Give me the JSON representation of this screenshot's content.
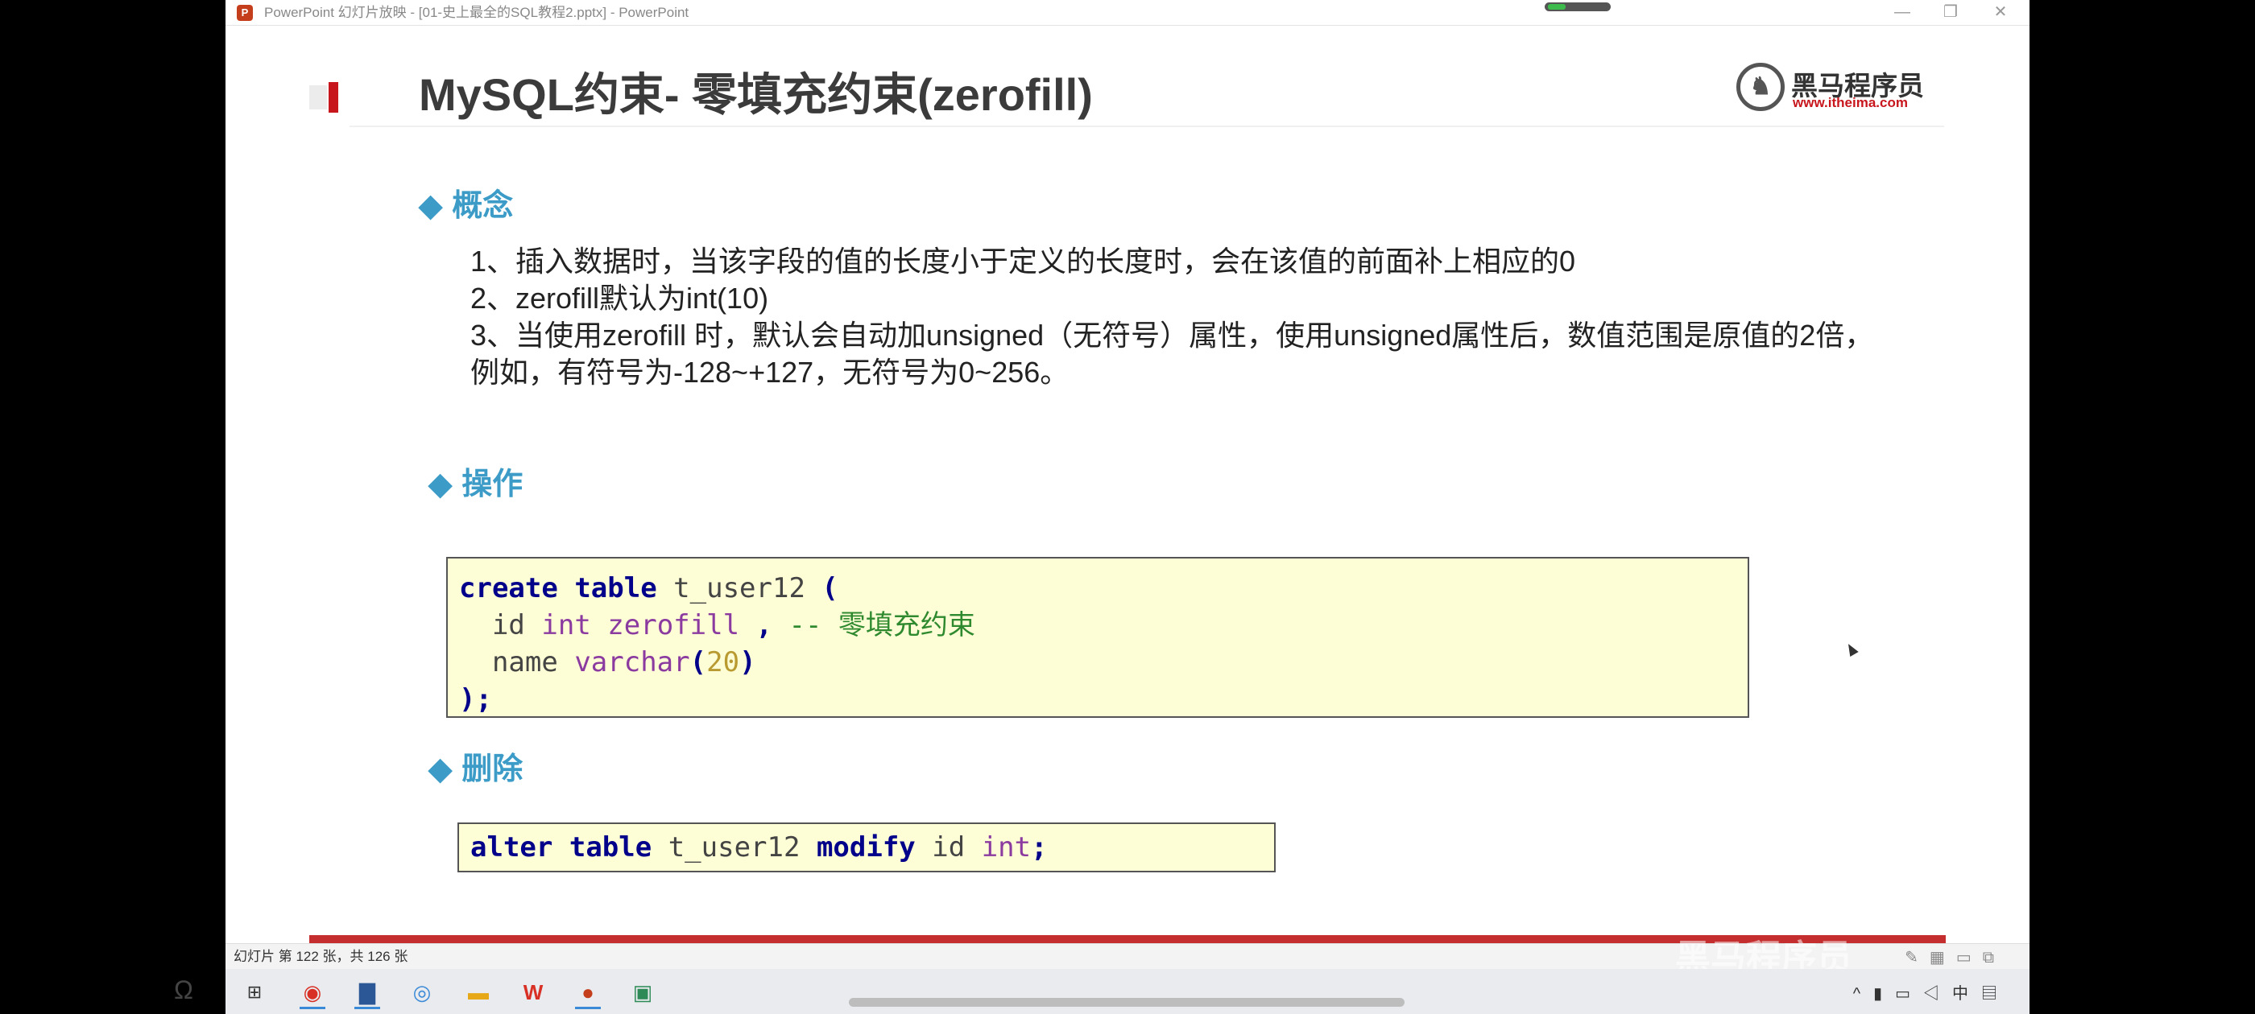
{
  "window": {
    "title": "PowerPoint 幻灯片放映 - [01-史上最全的SQL教程2.pptx] - PowerPoint",
    "app_icon_letter": "P",
    "minimize_icon": "minimize-icon",
    "restore_icon": "restore-icon",
    "close_icon": "close-icon"
  },
  "slide": {
    "title": "MySQL约束- 零填充约束(zerofill)",
    "logo_name": "黑马程序员",
    "logo_url": "www.itheima.com",
    "sections": {
      "concept": "概念",
      "operation": "操作",
      "delete": "删除"
    },
    "bullets": [
      "1、插入数据时，当该字段的值的长度小于定义的长度时，会在该值的前面补上相应的0",
      "2、zerofill默认为int(10)",
      "3、当使用zerofill 时，默认会自动加unsigned（无符号）属性，使用unsigned属性后，数值范围是原值的2倍，例如，有符号为-128~+127，无符号为0~256。"
    ],
    "code_create": {
      "l1_kw1": "create",
      "l1_kw2": "table",
      "l1_name": "t_user12",
      "l1_paren": "(",
      "l2_col": "id",
      "l2_type1": "int",
      "l2_type2": "zerofill",
      "l2_sep": ",",
      "l2_comment": "-- 零填充约束",
      "l3_col": "name",
      "l3_type": "varchar",
      "l3_open": "(",
      "l3_num": "20",
      "l3_close": ")",
      "l4_end": ");"
    },
    "code_alter": {
      "kw1": "alter",
      "kw2": "table",
      "name": "t_user12",
      "kw3": "modify",
      "col": "id",
      "type": "int",
      "end": ";"
    }
  },
  "status": {
    "slide_counter": "幻灯片 第 122 张，共 126 张",
    "watermark": "黑马程序员"
  },
  "taskbar": {
    "apps": [
      "windows-start-icon",
      "chrome-icon",
      "word-icon",
      "browser-icon",
      "file-explorer-icon",
      "wps-icon",
      "powerpoint-icon",
      "image-editor-icon"
    ]
  },
  "colors": {
    "accent_blue": "#3c9cc7",
    "brand_red": "#c8161d",
    "code_bg": "#fefed6"
  }
}
